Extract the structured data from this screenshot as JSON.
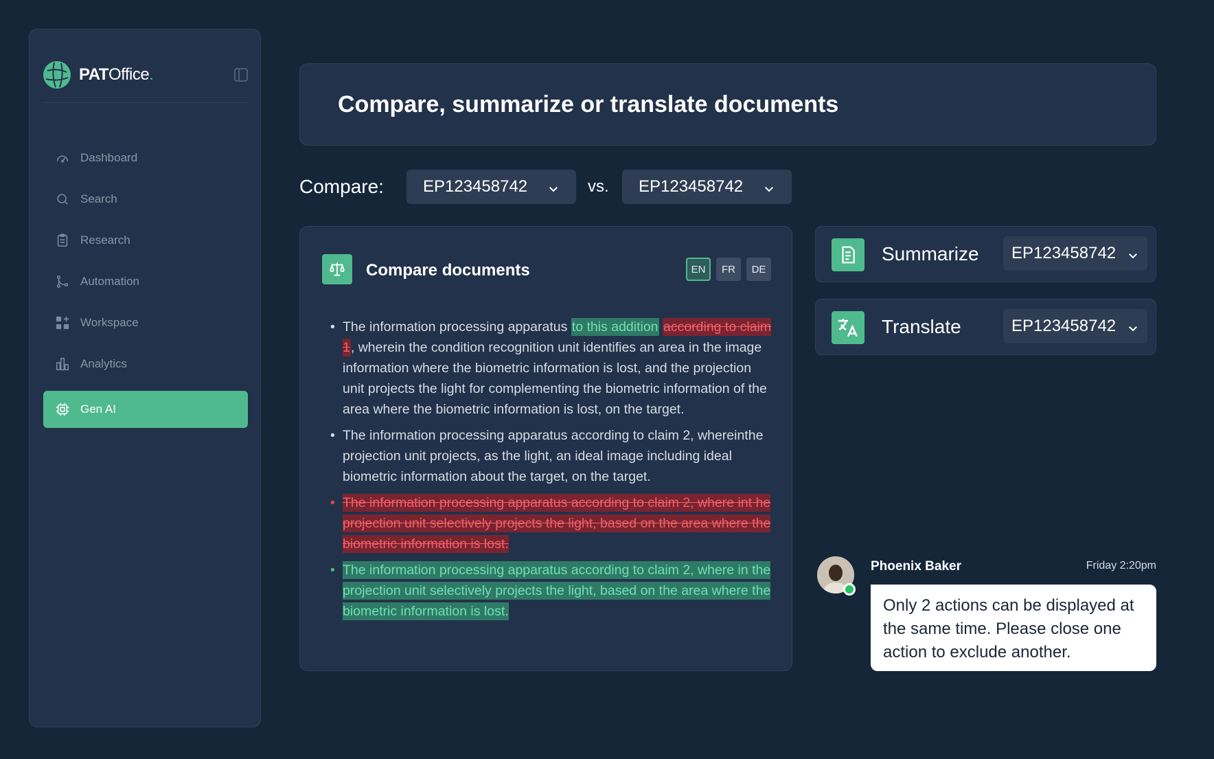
{
  "brand": {
    "name_bold": "PAT",
    "name_rest": "Office",
    "name_dot": "."
  },
  "sidebar": {
    "items": [
      {
        "label": "Dashboard",
        "icon": "dashboard-icon"
      },
      {
        "label": "Search",
        "icon": "search-icon"
      },
      {
        "label": "Research",
        "icon": "clipboard-icon"
      },
      {
        "label": "Automation",
        "icon": "git-branch-icon"
      },
      {
        "label": "Workspace",
        "icon": "grid-plus-icon"
      },
      {
        "label": "Analytics",
        "icon": "bar-chart-icon"
      },
      {
        "label": "Gen AI",
        "icon": "chip-icon",
        "active": true
      }
    ]
  },
  "header": {
    "title": "Compare, summarize or translate documents"
  },
  "compare": {
    "label": "Compare:",
    "left_doc": "EP123458742",
    "vs_label": "vs.",
    "right_doc": "EP123458742"
  },
  "compare_card": {
    "title": "Compare documents",
    "languages": [
      "EN",
      "FR",
      "DE"
    ],
    "active_language": "EN",
    "item1": {
      "pre": "The information processing apparatus ",
      "inserted": "to this addition",
      "removed": "according to claim 1",
      "post": ", wherein the condition recognition unit identifies an area in the image information where the biometric information is lost, and the projection unit projects the light for complementing the biometric information of the area where the biometric information is lost, on the target."
    },
    "item2": "The information processing apparatus according to claim 2, whereinthe projection unit projects, as the light, an ideal image including ideal biometric information about the target, on the target.",
    "item3_removed": "The information processing apparatus according to claim 2, where int he projection unit selectively projects the light, based on the area where the biometric information is lost.",
    "item4_inserted": "The information processing apparatus according to claim 2, where in the projection unit selectively projects the light, based on the area where the biometric information is lost."
  },
  "actions": [
    {
      "label": "Summarize",
      "doc": "EP123458742",
      "icon": "document-icon"
    },
    {
      "label": "Translate",
      "doc": "EP123458742",
      "icon": "translate-icon"
    }
  ],
  "chat": {
    "name": "Phoenix Baker",
    "time": "Friday 2:20pm",
    "message": "Only 2 actions can be displayed at the same time. Please close one action to exclude another."
  },
  "colors": {
    "background": "#152639",
    "panel": "#22324a",
    "accent": "#4fba8e",
    "insert_bg": "#2f7a67",
    "delete_bg": "#7a2430",
    "status_online": "#22c55e"
  }
}
